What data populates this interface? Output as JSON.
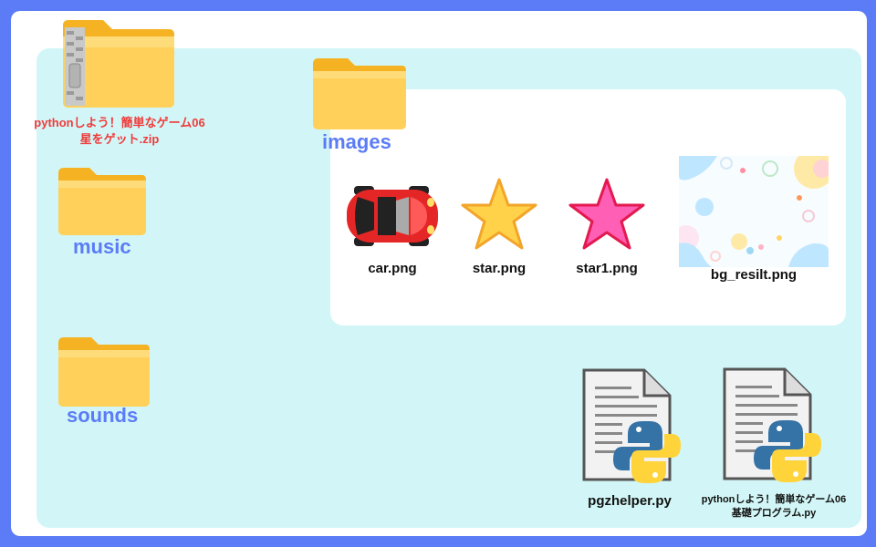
{
  "zip": {
    "line1": "pythonしよう！簡単なゲーム06",
    "line2": "星をゲット.zip"
  },
  "folders": {
    "music": "music",
    "sounds": "sounds",
    "images": "images"
  },
  "images": {
    "car": "car.png",
    "star": "star.png",
    "star1": "star1.png",
    "bg": "bg_resilt.png"
  },
  "files": {
    "helper": "pgzhelper.py",
    "base_line1": "pythonしよう！簡単なゲーム06",
    "base_line2": "基礎プログラム.py"
  },
  "colors": {
    "frame": "#5b7cf6",
    "panel": "#d2f6f7",
    "folder": "#ffc83d",
    "zip_label": "#f03a3a"
  }
}
